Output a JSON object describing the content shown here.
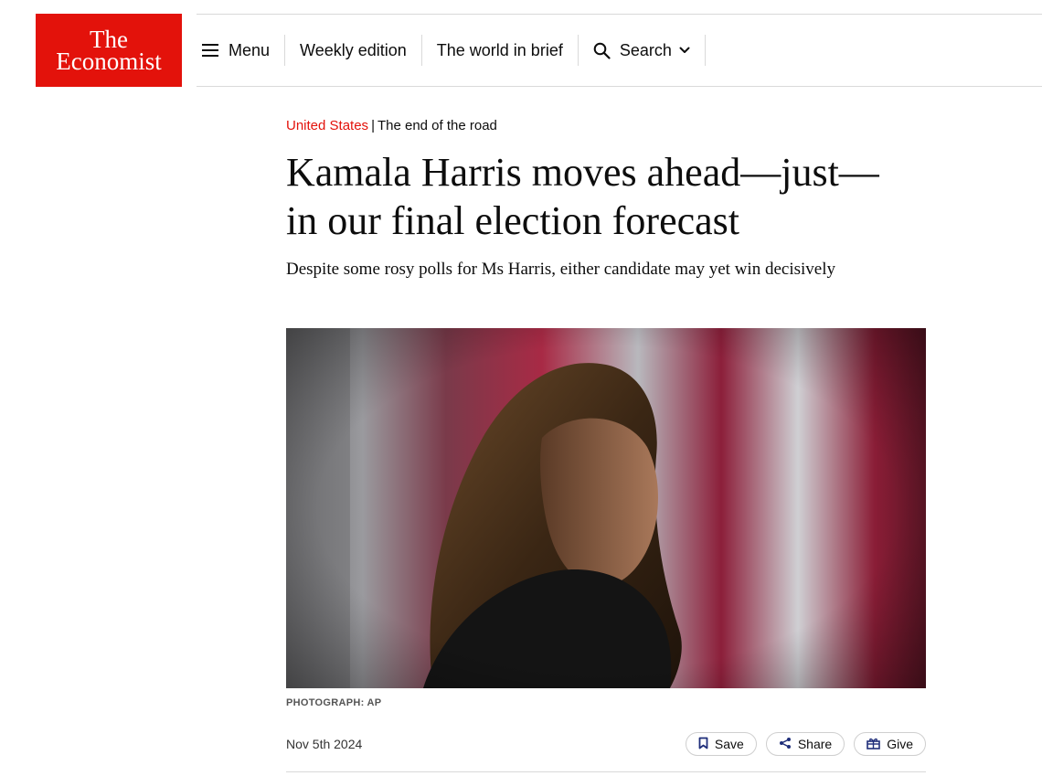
{
  "brand": {
    "line1": "The",
    "line2": "Economist",
    "color": "#e3120b"
  },
  "nav": {
    "menu_label": "Menu",
    "weekly_label": "Weekly edition",
    "brief_label": "The world in brief",
    "search_label": "Search",
    "icons": [
      "hamburger-icon",
      "search-icon",
      "chevron-down-icon"
    ]
  },
  "article": {
    "section": "United States",
    "separator": "|",
    "flytitle": "The end of the road",
    "headline": "Kamala Harris moves ahead—just—in our final election forecast",
    "standfirst": "Despite some rosy polls for Ms Harris, either candidate may yet win decisively",
    "image_credit": "PHOTOGRAPH: AP",
    "date": "Nov 5th 2024"
  },
  "actions": {
    "save_label": "Save",
    "share_label": "Share",
    "give_label": "Give",
    "icons": [
      "bookmark-icon",
      "share-icon",
      "gift-icon"
    ]
  }
}
